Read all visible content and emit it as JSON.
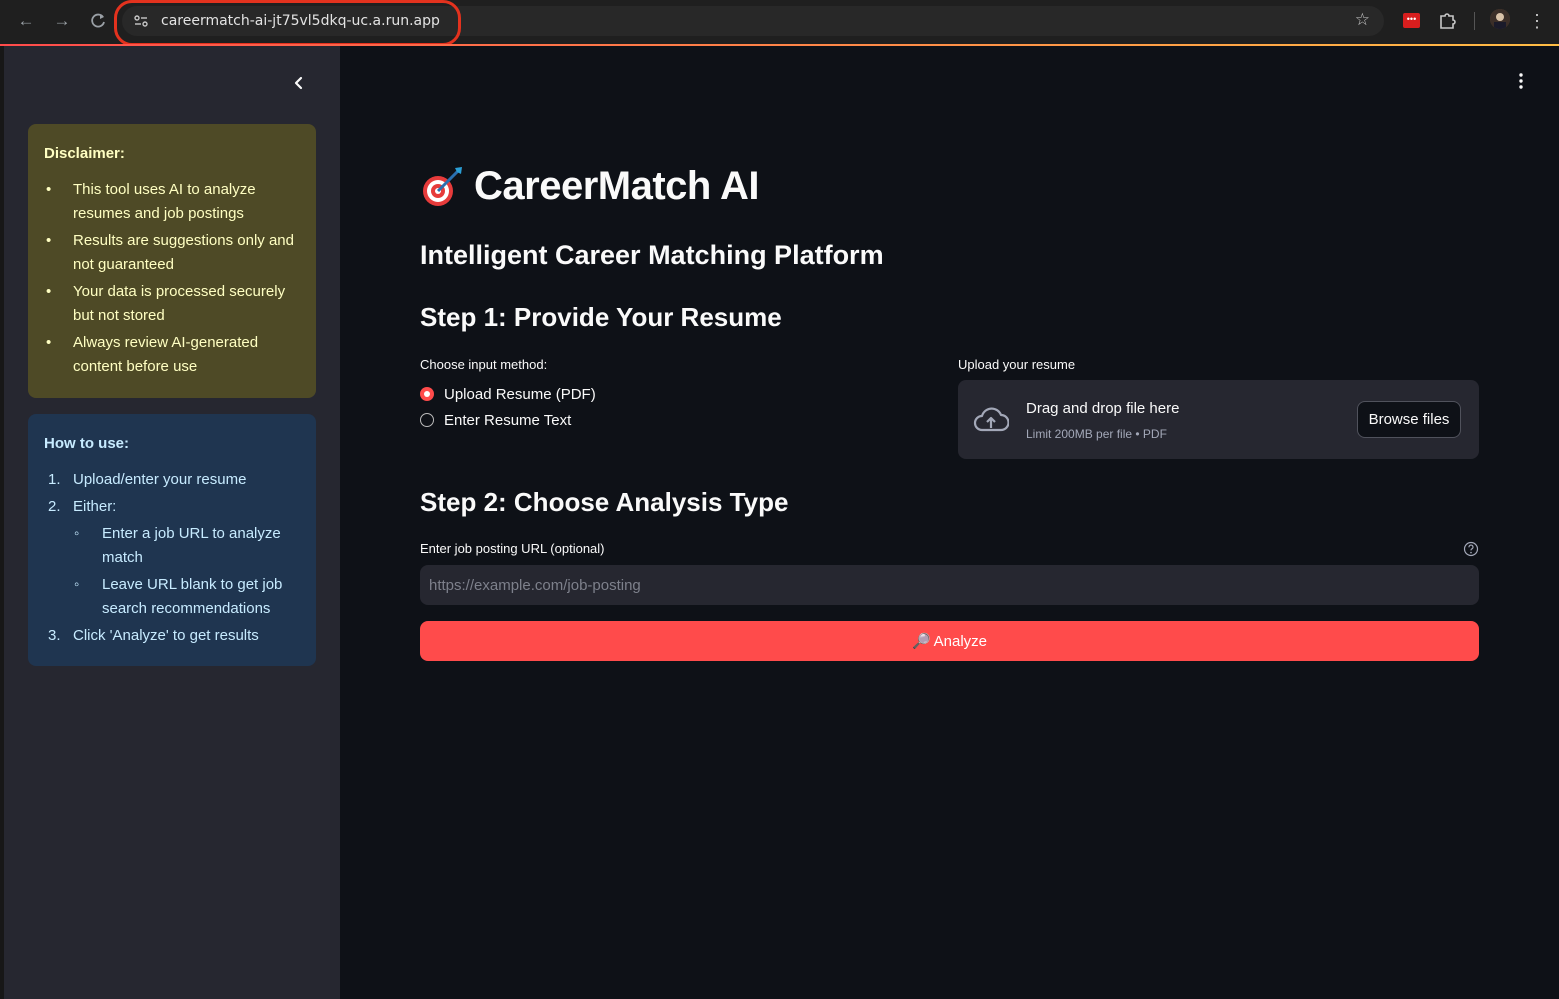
{
  "browser": {
    "url": "careermatch-ai-jt75vl5dkq-uc.a.run.app",
    "icons": [
      "back-icon",
      "forward-icon",
      "reload-icon",
      "site-info-icon",
      "bookmark-star-icon",
      "extension-icon",
      "puzzle-icon",
      "profile-avatar",
      "kebab-menu-icon"
    ]
  },
  "sidebar": {
    "disclaimer": {
      "title": "Disclaimer:",
      "items": [
        "This tool uses AI to analyze resumes and job postings",
        "Results are suggestions only and not guaranteed",
        "Your data is processed securely but not stored",
        "Always review AI-generated content before use"
      ]
    },
    "how_to": {
      "title": "How to use:",
      "steps": [
        {
          "num": "1.",
          "text": "Upload/enter your resume"
        },
        {
          "num": "2.",
          "text": "Either:"
        },
        {
          "num": "3.",
          "text": "Click 'Analyze' to get results"
        }
      ],
      "sub_steps": [
        "Enter a job URL to analyze match",
        "Leave URL blank to get job search recommendations"
      ]
    }
  },
  "main": {
    "title": "CareerMatch AI",
    "subtitle": "Intelligent Career Matching Platform",
    "step1": {
      "heading": "Step 1: Provide Your Resume",
      "method_label": "Choose input method:",
      "options": [
        "Upload Resume (PDF)",
        "Enter Resume Text"
      ],
      "selected": "Upload Resume (PDF)"
    },
    "uploader": {
      "label": "Upload your resume",
      "drag_text": "Drag and drop file here",
      "limit_text": "Limit 200MB per file • PDF",
      "browse_label": "Browse files"
    },
    "step2": {
      "heading": "Step 2: Choose Analysis Type",
      "url_label": "Enter job posting URL (optional)",
      "url_placeholder": "https://example.com/job-posting",
      "url_value": ""
    },
    "analyze": {
      "icon": "🔎",
      "label": "Analyze"
    }
  },
  "colors": {
    "primary": "#ff4b4b",
    "background": "#0e1117",
    "sidebar": "#262730",
    "warning_bg": "#4e4a26",
    "info_bg": "#1f3550"
  }
}
